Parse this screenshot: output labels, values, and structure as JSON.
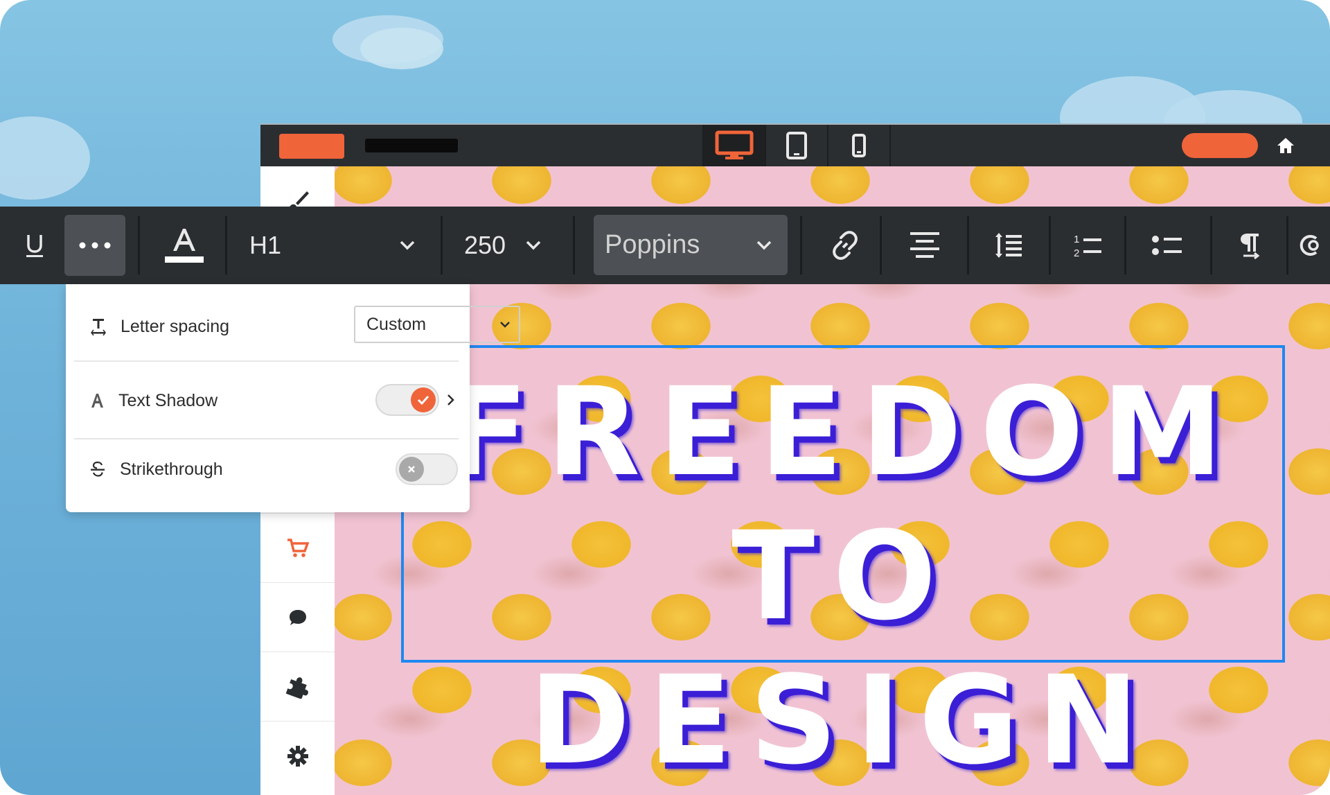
{
  "format_toolbar": {
    "heading_level": "H1",
    "font_size": "250",
    "font_family": "Poppins"
  },
  "text_options": {
    "letter_spacing_label": "Letter spacing",
    "letter_spacing_value": "Custom",
    "text_shadow_label": "Text Shadow",
    "text_shadow_enabled": true,
    "strikethrough_label": "Strikethrough",
    "strikethrough_enabled": false
  },
  "canvas": {
    "headline_line1": "FREEDOM",
    "headline_line2": "TO DESIGN"
  },
  "device_preview": {
    "active": "desktop",
    "options": [
      "desktop",
      "tablet",
      "mobile"
    ]
  },
  "sidebar_icons": [
    "brush-icon",
    "cart-icon",
    "chat-icon",
    "puzzle-icon",
    "gear-icon"
  ],
  "colors": {
    "accent": "#f0643a",
    "toolbar_bg": "#2b2e31",
    "selection": "#1e88f0",
    "text_shadow": "#3b1fd6",
    "canvas_bg": "#f1c3d2"
  }
}
